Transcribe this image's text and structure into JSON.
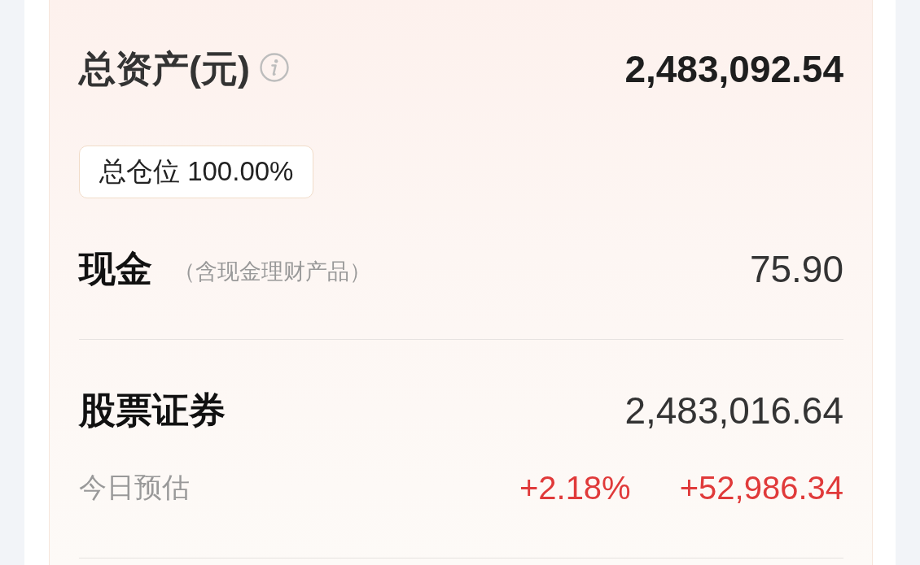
{
  "summary": {
    "title": "总资产(元)",
    "value": "2,483,092.54"
  },
  "position_badge": {
    "text": "总仓位 100.00%"
  },
  "sections": [
    {
      "title": "现金",
      "note": "（含现金理财产品）",
      "value": "75.90"
    },
    {
      "title": "股票证券",
      "value": "2,483,016.64",
      "estimate": {
        "label": "今日预估",
        "percent": "+2.18%",
        "amount": "+52,986.34"
      }
    }
  ]
}
